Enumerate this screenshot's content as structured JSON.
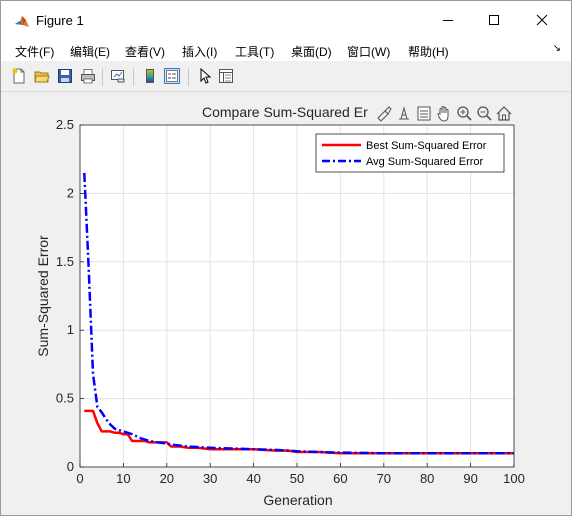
{
  "window": {
    "title": "Figure 1",
    "minimize_icon": "minimize-icon",
    "maximize_icon": "maximize-icon",
    "close_icon": "close-icon"
  },
  "menu": [
    {
      "label": "文件(F)"
    },
    {
      "label": "编辑(E)"
    },
    {
      "label": "查看(V)"
    },
    {
      "label": "插入(I)"
    },
    {
      "label": "工具(T)"
    },
    {
      "label": "桌面(D)"
    },
    {
      "label": "窗口(W)"
    },
    {
      "label": "帮助(H)"
    }
  ],
  "menu_extra_icon": "dock-arrow-icon",
  "toolbar": [
    "new-figure-icon",
    "open-file-icon",
    "save-icon",
    "print-icon",
    "link-plot-icon",
    "colorbar-icon",
    "legend-icon",
    "edit-plot-icon",
    "property-inspector-icon"
  ],
  "axes_toolbar": [
    "brush-icon",
    "data-tips-icon",
    "zoom-pan-icon",
    "pan-icon",
    "zoom-in-icon",
    "zoom-out-icon",
    "home-icon"
  ],
  "chart_data": {
    "type": "line",
    "title": "Compare Sum-Squared Er",
    "xlabel": "Generation",
    "ylabel": "Sum-Squared Error",
    "xlim": [
      0,
      100
    ],
    "ylim": [
      0,
      2.5
    ],
    "xticks": [
      "0",
      "10",
      "20",
      "30",
      "40",
      "50",
      "60",
      "70",
      "80",
      "90",
      "100"
    ],
    "yticks": [
      "0",
      "0.5",
      "1",
      "1.5",
      "2",
      "2.5"
    ],
    "grid": true,
    "legend_position": "top-right",
    "series": [
      {
        "name": "Best Sum-Squared Error",
        "color": "#ff0000",
        "style": "solid",
        "x": [
          1,
          2,
          3,
          4,
          5,
          6,
          7,
          8,
          9,
          10,
          11,
          12,
          13,
          14,
          15,
          16,
          17,
          18,
          19,
          20,
          21,
          22,
          23,
          25,
          27,
          30,
          35,
          40,
          45,
          48,
          50,
          55,
          60,
          70,
          80,
          90,
          100
        ],
        "y": [
          0.41,
          0.41,
          0.41,
          0.32,
          0.26,
          0.26,
          0.26,
          0.25,
          0.25,
          0.24,
          0.24,
          0.19,
          0.19,
          0.19,
          0.19,
          0.18,
          0.18,
          0.18,
          0.18,
          0.18,
          0.15,
          0.15,
          0.15,
          0.14,
          0.14,
          0.13,
          0.13,
          0.13,
          0.12,
          0.12,
          0.11,
          0.11,
          0.1,
          0.1,
          0.1,
          0.1,
          0.1
        ]
      },
      {
        "name": "Avg Sum-Squared Error",
        "color": "#0000ff",
        "style": "dashdot",
        "x": [
          1,
          2,
          3,
          4,
          5,
          6,
          7,
          8,
          9,
          10,
          12,
          14,
          16,
          18,
          20,
          22,
          25,
          30,
          35,
          40,
          45,
          48,
          50,
          55,
          60,
          70,
          80,
          90,
          100
        ],
        "y": [
          2.15,
          1.45,
          0.68,
          0.44,
          0.4,
          0.35,
          0.31,
          0.28,
          0.27,
          0.26,
          0.24,
          0.21,
          0.19,
          0.18,
          0.17,
          0.16,
          0.15,
          0.14,
          0.135,
          0.13,
          0.125,
          0.12,
          0.115,
          0.11,
          0.105,
          0.1,
          0.1,
          0.1,
          0.1
        ]
      }
    ]
  }
}
